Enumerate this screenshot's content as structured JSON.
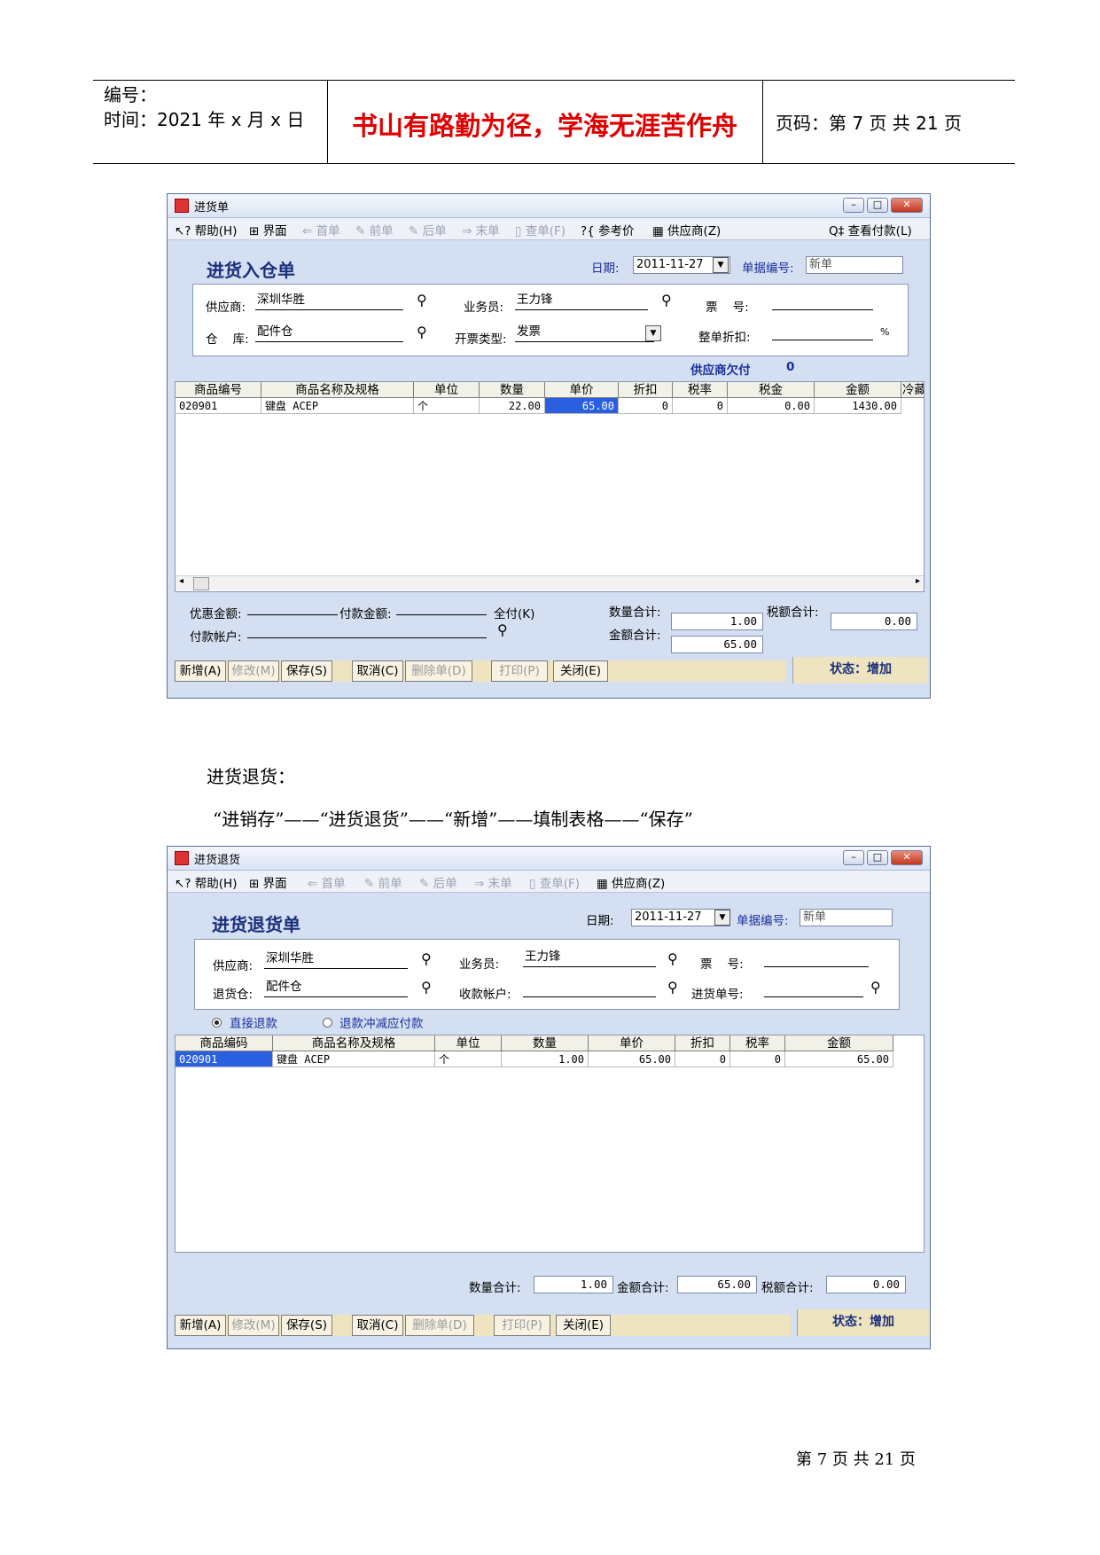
{
  "header": {
    "number_label": "编号：",
    "time_label": "时间：2021 年 x 月 x 日",
    "motto": "书山有路勤为径，学海无涯苦作舟",
    "page_info": "页码：第 7 页  共 21 页"
  },
  "win1": {
    "title": "进货单",
    "toolbar": [
      "帮助(H)",
      "界面",
      "首单",
      "前单",
      "后单",
      "末单",
      "查单(F)",
      "参考价",
      "供应商(Z)",
      "查看付款(L)"
    ],
    "form_title": "进货入仓单",
    "date_label": "日期:",
    "date_value": "2011-11-27",
    "doc_no_label": "单据编号:",
    "doc_no_value": "新单",
    "supplier_label": "供应商:",
    "supplier_value": "深圳华胜",
    "salesman_label": "业务员:",
    "salesman_value": "王力锋",
    "ticket_label": "票    号:",
    "warehouse_label": "仓    库:",
    "warehouse_value": "配件仓",
    "invoice_type_label": "开票类型:",
    "invoice_type_value": "发票",
    "discount_label": "整单折扣:",
    "percent": "%",
    "arrears_label": "供应商欠付",
    "arrears_value": "0",
    "columns": [
      "商品编号",
      "商品名称及规格",
      "单位",
      "数量",
      "单价",
      "折扣",
      "税率",
      "税金",
      "金额",
      "冷藏"
    ],
    "rows": [
      [
        "020901",
        "键盘 ACEP",
        "个",
        "22.00",
        "65.00",
        "0",
        "0",
        "0.00",
        "1430.00"
      ]
    ],
    "discount_amt_label": "优惠金额:",
    "pay_amt_label": "付款金额:",
    "full_pay_label": "全付(K)",
    "pay_account_label": "付款帐户:",
    "qty_total_label": "数量合计:",
    "qty_total": "1.00",
    "tax_total_label": "税额合计:",
    "tax_total": "0.00",
    "amt_total_label": "金额合计:",
    "amt_total": "65.00",
    "buttons": [
      "新增(A)",
      "修改(M)",
      "保存(S)",
      "取消(C)",
      "删除单(D)",
      "打印(P)",
      "关闭(E)"
    ],
    "status": "状态：增加"
  },
  "text1": "进货退货：",
  "text2": "“进销存”——“进货退货”——“新增”——填制表格——“保存”",
  "win2": {
    "title": "进货退货",
    "toolbar": [
      "帮助(H)",
      "界面",
      "首单",
      "前单",
      "后单",
      "末单",
      "查单(F)",
      "供应商(Z)"
    ],
    "form_title": "进货退货单",
    "date_label": "日期:",
    "date_value": "2011-11-27",
    "doc_no_label": "单据编号:",
    "doc_no_value": "新单",
    "supplier_label": "供应商:",
    "supplier_value": "深圳华胜",
    "salesman_label": "业务员:",
    "salesman_value": "王力锋",
    "ticket_label": "票    号:",
    "return_wh_label": "退货仓:",
    "return_wh_value": "配件仓",
    "receive_acct_label": "收款帐户:",
    "purchase_no_label": "进货单号:",
    "radio1": "直接退款",
    "radio2": "退款冲减应付款",
    "columns": [
      "商品编码",
      "商品名称及规格",
      "单位",
      "数量",
      "单价",
      "折扣",
      "税率",
      "金额"
    ],
    "rows": [
      [
        "020901",
        "键盘 ACEP",
        "个",
        "1.00",
        "65.00",
        "0",
        "0",
        "65.00"
      ]
    ],
    "qty_total_label": "数量合计:",
    "qty_total": "1.00",
    "amt_total_label": "金额合计:",
    "amt_total": "65.00",
    "tax_total_label": "税额合计:",
    "tax_total": "0.00",
    "buttons": [
      "新增(A)",
      "修改(M)",
      "保存(S)",
      "取消(C)",
      "删除单(D)",
      "打印(P)",
      "关闭(E)"
    ],
    "status": "状态：增加"
  },
  "footer": "第 7 页 共 21 页"
}
